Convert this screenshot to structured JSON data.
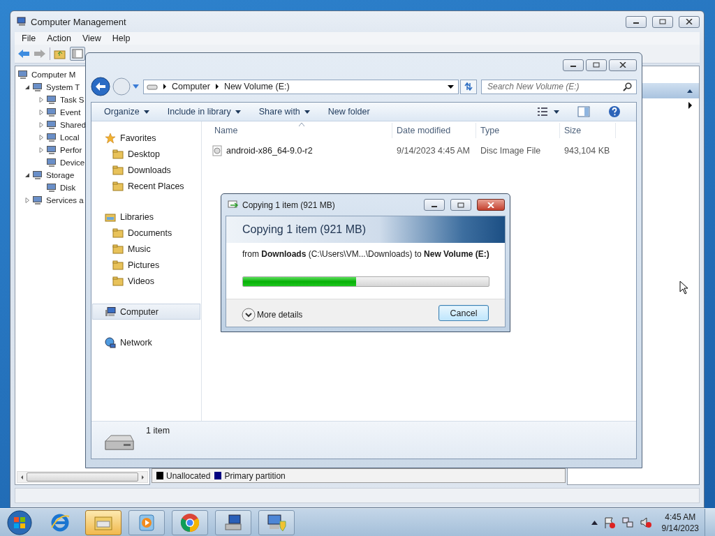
{
  "cm_window": {
    "title": "Computer Management",
    "menu": [
      "File",
      "Action",
      "View",
      "Help"
    ],
    "tree": [
      {
        "label": "Computer M",
        "children": [
          {
            "label": "System T",
            "expanded": true,
            "children": [
              {
                "label": "Task S",
                "expanded": false
              },
              {
                "label": "Event",
                "expanded": false
              },
              {
                "label": "Shared",
                "expanded": false
              },
              {
                "label": "Local",
                "expanded": false
              },
              {
                "label": "Perfor",
                "expanded": false
              },
              {
                "label": "Device"
              }
            ]
          },
          {
            "label": "Storage",
            "expanded": true,
            "children": [
              {
                "label": "Disk"
              }
            ]
          },
          {
            "label": "Services a",
            "expanded": false
          }
        ]
      }
    ],
    "legend": [
      {
        "label": "Unallocated",
        "color": "#000000"
      },
      {
        "label": "Primary partition",
        "color": "#000080"
      }
    ]
  },
  "explorer": {
    "address": [
      "Computer",
      "New Volume (E:)"
    ],
    "search": {
      "placeholder": "Search New Volume (E:)"
    },
    "commands": [
      {
        "label": "Organize",
        "dropdown": true
      },
      {
        "label": "Include in library",
        "dropdown": true
      },
      {
        "label": "Share with",
        "dropdown": true
      },
      {
        "label": "New folder",
        "dropdown": false
      }
    ],
    "nav": [
      {
        "label": "Favorites",
        "selected": false,
        "children": [
          {
            "label": "Desktop",
            "selected": false
          },
          {
            "label": "Downloads",
            "selected": false
          },
          {
            "label": "Recent Places",
            "selected": false
          }
        ]
      },
      {
        "label": "Libraries",
        "selected": false,
        "children": [
          {
            "label": "Documents",
            "selected": false
          },
          {
            "label": "Music",
            "selected": false
          },
          {
            "label": "Pictures",
            "selected": false
          },
          {
            "label": "Videos",
            "selected": false
          }
        ]
      },
      {
        "label": "Computer",
        "selected": true
      },
      {
        "label": "Network",
        "selected": false
      }
    ],
    "columns": [
      "Name",
      "Date modified",
      "Type",
      "Size"
    ],
    "rows": [
      {
        "name": "android-x86_64-9.0-r2",
        "date": "9/14/2023 4:45 AM",
        "type": "Disc Image File",
        "size": "943,104 KB"
      }
    ],
    "details": {
      "text": "1 item"
    }
  },
  "copy_dialog": {
    "title": "Copying 1 item (921 MB)",
    "heading": "Copying 1 item (921 MB)",
    "message": "from **Downloads** (C:\\Users\\VM...\\Downloads)  to **New Volume (E:)**",
    "progress": {
      "level": 0.46
    },
    "more_details": "More details",
    "cancel": "Cancel"
  },
  "taskbar": {
    "apps": [
      {
        "running": false,
        "selected": false
      },
      {
        "running": true,
        "selected": true
      },
      {
        "running": true,
        "selected": false
      },
      {
        "running": true,
        "selected": false
      },
      {
        "running": true,
        "selected": false
      },
      {
        "running": true,
        "selected": false
      }
    ],
    "clock": {
      "time": "4:45 AM",
      "date": "9/14/2023"
    }
  }
}
